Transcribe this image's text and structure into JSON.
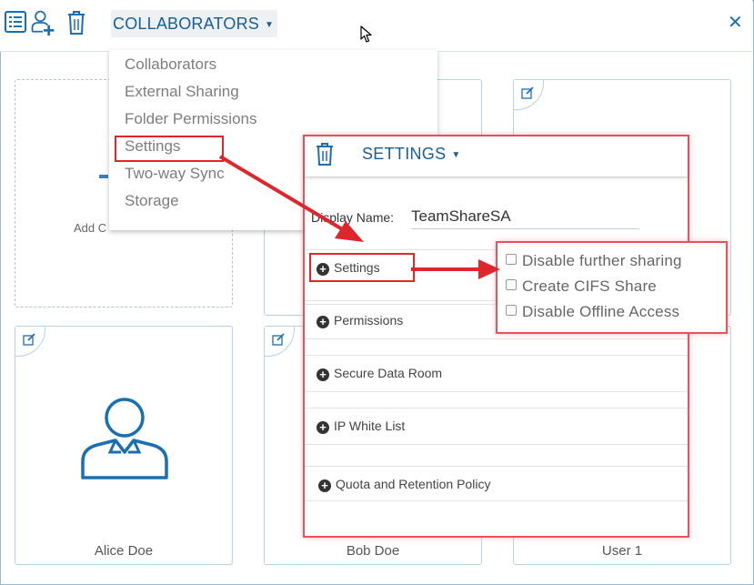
{
  "toolbar": {
    "collaborators_label": "COLLABORATORS",
    "close_glyph": "✕",
    "icons": [
      "list-view-icon",
      "add-user-icon",
      "trash-icon"
    ]
  },
  "dropdown": {
    "items": [
      {
        "label": "Collaborators"
      },
      {
        "label": "External Sharing"
      },
      {
        "label": "Folder Permissions"
      },
      {
        "label": "Settings"
      },
      {
        "label": "Two-way Sync"
      },
      {
        "label": "Storage"
      }
    ],
    "highlighted": "Settings"
  },
  "cards": {
    "add_label": "Add C",
    "alice": "Alice Doe",
    "bob": "Bob Doe",
    "user1": "User 1"
  },
  "settings_panel": {
    "title": "SETTINGS",
    "display_name_label": "Display Name:",
    "display_name_value": "TeamShareSA",
    "sections": [
      {
        "label": "Settings"
      },
      {
        "label": "Permissions"
      },
      {
        "label": "Secure Data Room"
      },
      {
        "label": "IP White List"
      },
      {
        "label": "Quota and Retention Policy"
      }
    ]
  },
  "settings_options": [
    {
      "label": "Disable further sharing",
      "checked": false
    },
    {
      "label": "Create CIFS Share",
      "checked": false
    },
    {
      "label": "Disable Offline Access",
      "checked": false
    }
  ],
  "colors": {
    "accent": "#1a5d99",
    "highlight": "#e0262d",
    "card_border": "#b3d4ea"
  }
}
